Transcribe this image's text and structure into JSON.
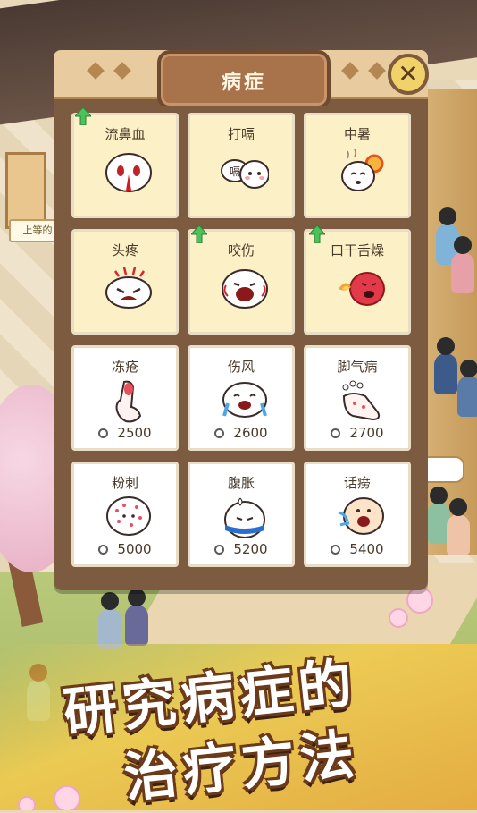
{
  "panel": {
    "title": "病症",
    "close_label": "✕"
  },
  "background": {
    "sign_text": "上等的"
  },
  "cards": [
    {
      "name": "流鼻血",
      "state": "researched",
      "new": true,
      "icon": "nosebleed-face-icon",
      "price": null
    },
    {
      "name": "打嗝",
      "state": "researched",
      "new": false,
      "icon": "hiccup-face-icon",
      "icon_text": "嗝",
      "price": null
    },
    {
      "name": "中暑",
      "state": "researched",
      "new": false,
      "icon": "heatstroke-face-icon",
      "price": null
    },
    {
      "name": "头疼",
      "state": "researched",
      "new": false,
      "icon": "headache-face-icon",
      "price": null
    },
    {
      "name": "咬伤",
      "state": "researched",
      "new": true,
      "icon": "bite-face-icon",
      "price": null
    },
    {
      "name": "口干舌燥",
      "state": "researched",
      "new": true,
      "icon": "dry-mouth-face-icon",
      "price": null
    },
    {
      "name": "冻疮",
      "state": "locked",
      "new": false,
      "icon": "frostbite-finger-icon",
      "price": "2500"
    },
    {
      "name": "伤风",
      "state": "locked",
      "new": false,
      "icon": "cold-face-icon",
      "price": "2600"
    },
    {
      "name": "脚气病",
      "state": "locked",
      "new": false,
      "icon": "athlete-foot-icon",
      "price": "2700"
    },
    {
      "name": "粉刺",
      "state": "locked",
      "new": false,
      "icon": "acne-face-icon",
      "price": "5000"
    },
    {
      "name": "腹胀",
      "state": "locked",
      "new": false,
      "icon": "bloating-face-icon",
      "price": "5200"
    },
    {
      "name": "话痨",
      "state": "locked",
      "new": false,
      "icon": "chatterbox-face-icon",
      "price": "5400"
    }
  ],
  "banner": {
    "line1": "研究病症的",
    "line2": "治疗方法"
  },
  "colors": {
    "panel_brown": "#7d5b40",
    "researched_card": "#fbf0c6",
    "locked_card": "#ffffff",
    "new_arrow": "#4cc25a",
    "close_yellow": "#f1d26a"
  }
}
